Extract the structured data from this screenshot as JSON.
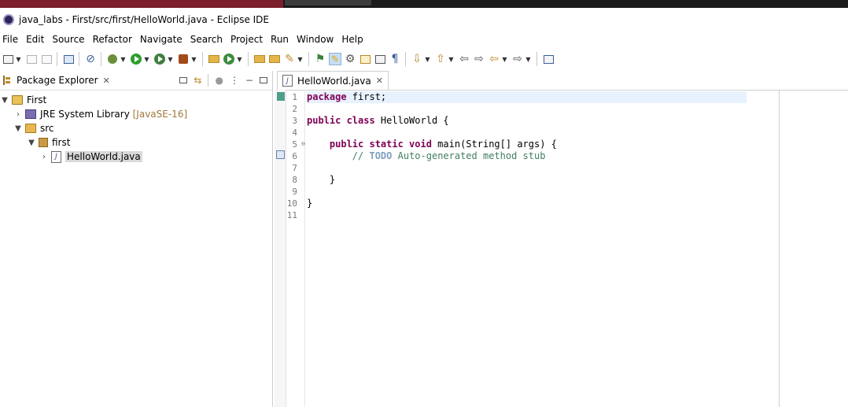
{
  "window": {
    "title": "java_labs - First/src/first/HelloWorld.java - Eclipse IDE"
  },
  "menu": [
    "File",
    "Edit",
    "Source",
    "Refactor",
    "Navigate",
    "Search",
    "Project",
    "Run",
    "Window",
    "Help"
  ],
  "package_explorer": {
    "tab_label": "Package Explorer",
    "tree": {
      "project": "First",
      "jre": "JRE System Library",
      "jre_version": "[JavaSE-16]",
      "src": "src",
      "package": "first",
      "file": "HelloWorld.java"
    }
  },
  "editor": {
    "tab_label": "HelloWorld.java",
    "line_numbers": [
      "1",
      "2",
      "3",
      "4",
      "5",
      "6",
      "7",
      "8",
      "9",
      "10",
      "11"
    ],
    "code": {
      "l1_kw": "package",
      "l1_rest": " first;",
      "l3_kw": "public class",
      "l3_rest": " HelloWorld {",
      "l5_indent": "    ",
      "l5_kw": "public static void",
      "l5_rest": " main(String[] args) {",
      "l6_indent": "        ",
      "l6_slashes": "// ",
      "l6_todo": "TODO",
      "l6_rest": " Auto-generated method stub",
      "l8": "    }",
      "l10": "}"
    }
  },
  "colors": {
    "keyword": "#7f0055",
    "comment": "#3f7f5f",
    "todo": "#7f9fbf"
  }
}
